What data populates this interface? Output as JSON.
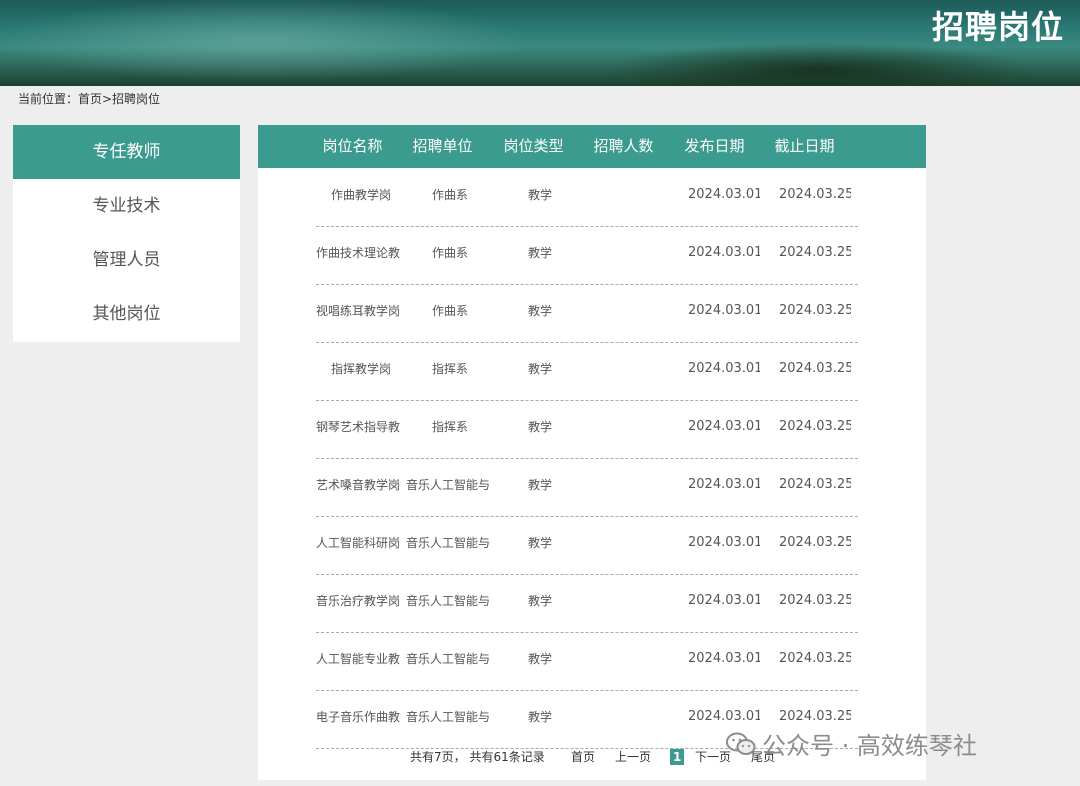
{
  "banner": {
    "title": "招聘岗位"
  },
  "breadcrumb": {
    "text": "当前位置：首页>招聘岗位"
  },
  "sidebar": {
    "items": [
      {
        "label": "专任教师",
        "active": true
      },
      {
        "label": "专业技术",
        "active": false
      },
      {
        "label": "管理人员",
        "active": false
      },
      {
        "label": "其他岗位",
        "active": false
      }
    ]
  },
  "table": {
    "headers": [
      "岗位名称",
      "招聘单位",
      "岗位类型",
      "招聘人数",
      "发布日期",
      "截止日期"
    ],
    "rows": [
      {
        "name": "作曲教学岗",
        "unit": "作曲系",
        "type": "教学",
        "count": "",
        "publish": "2024.03.01",
        "deadline": "2024.03.25"
      },
      {
        "name": "作曲技术理论教",
        "unit": "作曲系",
        "type": "教学",
        "count": "",
        "publish": "2024.03.01",
        "deadline": "2024.03.25"
      },
      {
        "name": "视唱练耳教学岗",
        "unit": "作曲系",
        "type": "教学",
        "count": "",
        "publish": "2024.03.01",
        "deadline": "2024.03.25"
      },
      {
        "name": "指挥教学岗",
        "unit": "指挥系",
        "type": "教学",
        "count": "",
        "publish": "2024.03.01",
        "deadline": "2024.03.25"
      },
      {
        "name": "钢琴艺术指导教",
        "unit": "指挥系",
        "type": "教学",
        "count": "",
        "publish": "2024.03.01",
        "deadline": "2024.03.25"
      },
      {
        "name": "艺术嗓音教学岗",
        "unit": "音乐人工智能与",
        "type": "教学",
        "count": "",
        "publish": "2024.03.01",
        "deadline": "2024.03.25"
      },
      {
        "name": "人工智能科研岗",
        "unit": "音乐人工智能与",
        "type": "教学",
        "count": "",
        "publish": "2024.03.01",
        "deadline": "2024.03.25"
      },
      {
        "name": "音乐治疗教学岗",
        "unit": "音乐人工智能与",
        "type": "教学",
        "count": "",
        "publish": "2024.03.01",
        "deadline": "2024.03.25"
      },
      {
        "name": "人工智能专业教",
        "unit": "音乐人工智能与",
        "type": "教学",
        "count": "",
        "publish": "2024.03.01",
        "deadline": "2024.03.25"
      },
      {
        "name": "电子音乐作曲教",
        "unit": "音乐人工智能与",
        "type": "教学",
        "count": "",
        "publish": "2024.03.01",
        "deadline": "2024.03.25"
      }
    ]
  },
  "pagination": {
    "summary": "共有7页， 共有61条记录",
    "first": "首页",
    "prev": "上一页",
    "current": "1",
    "next": "下一页",
    "last": "尾页"
  },
  "watermark": {
    "text": "公众号 · 高效练琴社"
  },
  "colors": {
    "accent": "#3a9b8e",
    "background": "#eeeeee"
  }
}
